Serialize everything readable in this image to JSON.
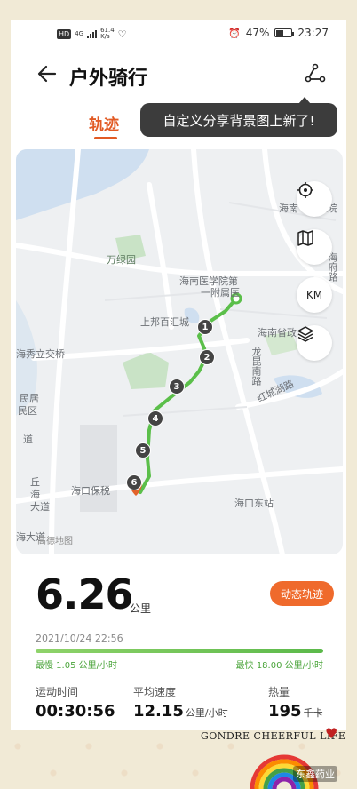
{
  "status_bar": {
    "net_badge": "HD",
    "network": "4G",
    "net_speed": "61.4",
    "net_speed_unit": "K/s",
    "battery_percent": "47%",
    "time": "23:27"
  },
  "header": {
    "title": "户外骑行"
  },
  "tabs": {
    "active": "轨迹"
  },
  "tooltip": {
    "text": "自定义分享背景图上新了!"
  },
  "map": {
    "labels": {
      "wanlvyuan": "万绿园",
      "hainan_med": "海南医学院第",
      "hainan_med2": "一附属医",
      "shangbang": "上邦百汇城",
      "haixiu": "海秀立交桥",
      "minsheng": "民居",
      "minsheng2": "民区",
      "dao": "道",
      "qiu": "丘",
      "hai": "海",
      "dadao": "大道",
      "haidadao": "海大道",
      "haikou_baoshui": "海口保税",
      "longkun": "龙昆南路",
      "hongcheng": "红城湖路",
      "haikou_east": "海口东站",
      "hainan_prov": "海南省政",
      "haifu": "海府路",
      "hainan_top": "海南",
      "yiyuan": "医院"
    },
    "markers": [
      "1",
      "2",
      "3",
      "4",
      "5",
      "6"
    ],
    "buttons": {
      "km": "KM"
    },
    "provider": "高德地图"
  },
  "summary": {
    "distance": "6.26",
    "distance_unit": "公里",
    "dynamic_track_button": "动态轨迹",
    "datetime": "2021/10/24 22:56",
    "slowest": "最慢 1.05 公里/小时",
    "fastest": "最快 18.00 公里/小时"
  },
  "stats": [
    {
      "label": "运动时间",
      "value": "00:30:56",
      "unit": ""
    },
    {
      "label": "平均速度",
      "value": "12.15",
      "unit": "公里/小时"
    },
    {
      "label": "热量",
      "value": "195",
      "unit": "千卡"
    }
  ],
  "decoration": {
    "brand": "GONDRE CHEERFUL LIFE",
    "watermark": "东鑫药业"
  },
  "colors": {
    "accent": "#ef6a2c",
    "route": "#5bbf4a",
    "marker": "#444444"
  }
}
